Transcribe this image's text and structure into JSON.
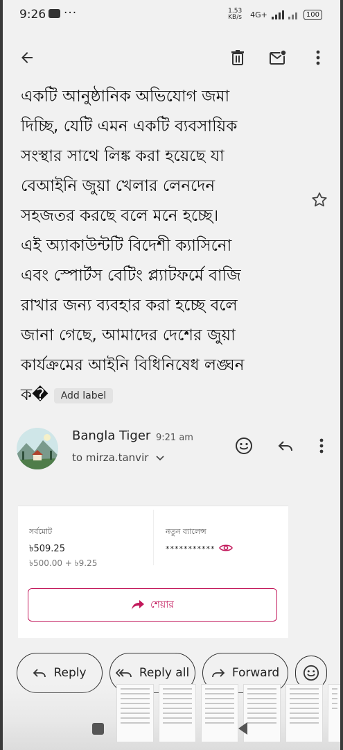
{
  "status_bar": {
    "time": "9:26",
    "dots": "···",
    "net_speed": "1.53 KB/s",
    "network": "4G+",
    "battery": "100"
  },
  "toolbar": {
    "back_icon": "arrow-back-icon",
    "delete_icon": "trash-icon",
    "mark_unread_icon": "mark-unread-icon",
    "more_icon": "more-vert-icon"
  },
  "email_body": {
    "lines": [
      "একটি আনুষ্ঠানিক অভিযোগ জমা",
      "দিচ্ছি, যেটি এমন একটি ব্যবসায়িক",
      "সংস্থার সাথে লিঙ্ক করা হয়েছে যা",
      "বেআইনি জুয়া খেলার লেনদেন",
      "সহজতর করছে বলে মনে হচ্ছে।",
      "এই অ্যাকাউন্টটি বিদেশী ক্যাসিনো",
      "এবং স্পোর্টস বেটিং প্ল্যাটফর্মে বাজি",
      "রাখার জন্য ব্যবহার করা হচ্ছে বলে",
      "জানা গেছে, আমাদের দেশের জুয়া",
      "কার্যক্রমের আইনি বিধিনিষেধ লঙ্ঘন"
    ],
    "last_line": "ক�",
    "add_label": "Add label"
  },
  "message": {
    "sender": "Bangla Tiger",
    "time": "9:21 am",
    "to": "to mirza.tanvir"
  },
  "card": {
    "total_label": "সর্বমোট",
    "total_amount": "৳509.25",
    "total_breakdown": "৳500.00 + ৳9.25",
    "new_balance_label": "নতুন ব্যালেন্স",
    "new_balance_masked": "***********",
    "share_label": "শেয়ার",
    "accent_color": "#c2185b"
  },
  "actions": {
    "reply": "Reply",
    "reply_all": "Reply all",
    "forward": "Forward"
  }
}
